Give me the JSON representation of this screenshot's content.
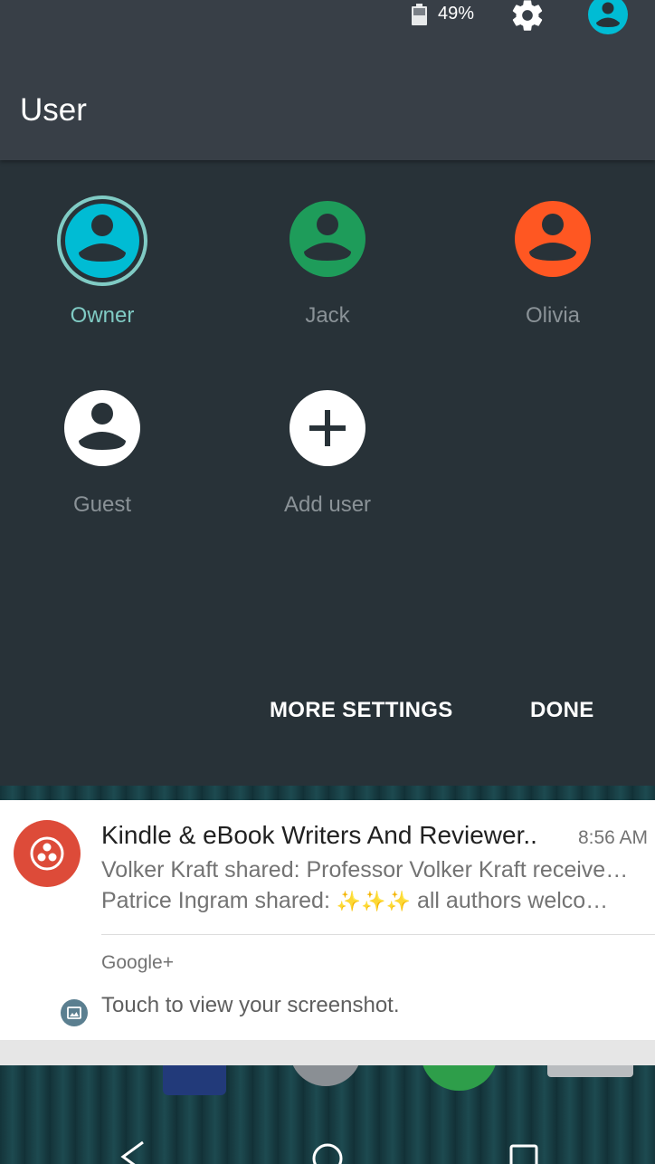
{
  "status_bar": {
    "battery_percent": "49%",
    "battery_level": 0.49
  },
  "header": {
    "title": "User",
    "icons": [
      "battery-icon",
      "settings-gear-icon",
      "user-avatar-icon"
    ]
  },
  "users": [
    {
      "name": "Owner",
      "color": "#00bcd4",
      "active": true
    },
    {
      "name": "Jack",
      "color": "#1e9c5a",
      "active": false
    },
    {
      "name": "Olivia",
      "color": "#ff5722",
      "active": false
    },
    {
      "name": "Guest",
      "color": "#ffffff",
      "active": false
    },
    {
      "name": "Add user",
      "color": "#ffffff",
      "active": false
    }
  ],
  "actions": {
    "more_settings": "MORE SETTINGS",
    "done": "DONE"
  },
  "notifications": [
    {
      "title": "Kindle & eBook Writers And Reviewer..",
      "time": "8:56 AM",
      "line1": "Volker Kraft shared: Professor Volker Kraft receive…",
      "line2_prefix": "Patrice Ingram shared: ",
      "line2_sparkles": "✨✨✨",
      "line2_suffix": " all authors welco…",
      "app": "Google+",
      "icon_color": "#dd4b39"
    },
    {
      "text": "Touch to view your screenshot."
    }
  ],
  "colors": {
    "header_bg": "#383f47",
    "panel_bg": "#283238",
    "accent": "#80cbc4"
  }
}
